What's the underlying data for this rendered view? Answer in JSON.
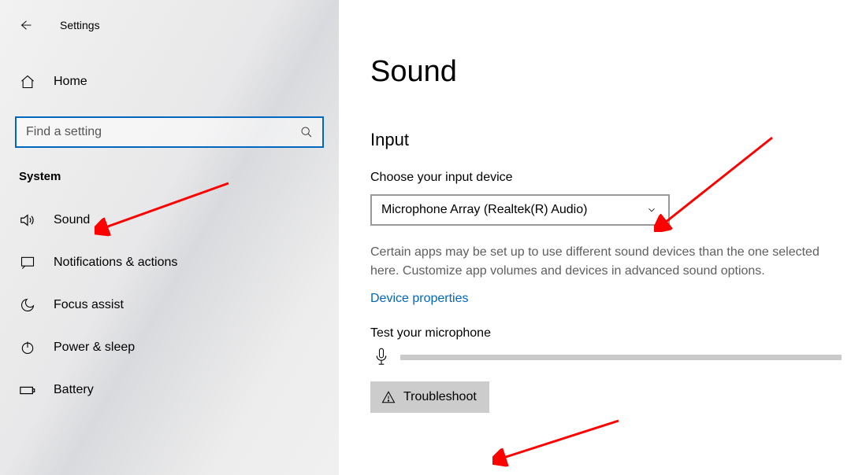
{
  "header": {
    "app_title": "Settings"
  },
  "sidebar": {
    "home_label": "Home",
    "search_placeholder": "Find a setting",
    "section": "System",
    "items": [
      {
        "label": "Sound"
      },
      {
        "label": "Notifications & actions"
      },
      {
        "label": "Focus assist"
      },
      {
        "label": "Power & sleep"
      },
      {
        "label": "Battery"
      }
    ]
  },
  "main": {
    "title": "Sound",
    "input_heading": "Input",
    "choose_label": "Choose your input device",
    "dropdown_value": "Microphone Array (Realtek(R) Audio)",
    "help_text": "Certain apps may be set up to use different sound devices than the one selected here. Customize app volumes and devices in advanced sound options.",
    "device_properties": "Device properties",
    "test_label": "Test your microphone",
    "troubleshoot": "Troubleshoot"
  }
}
